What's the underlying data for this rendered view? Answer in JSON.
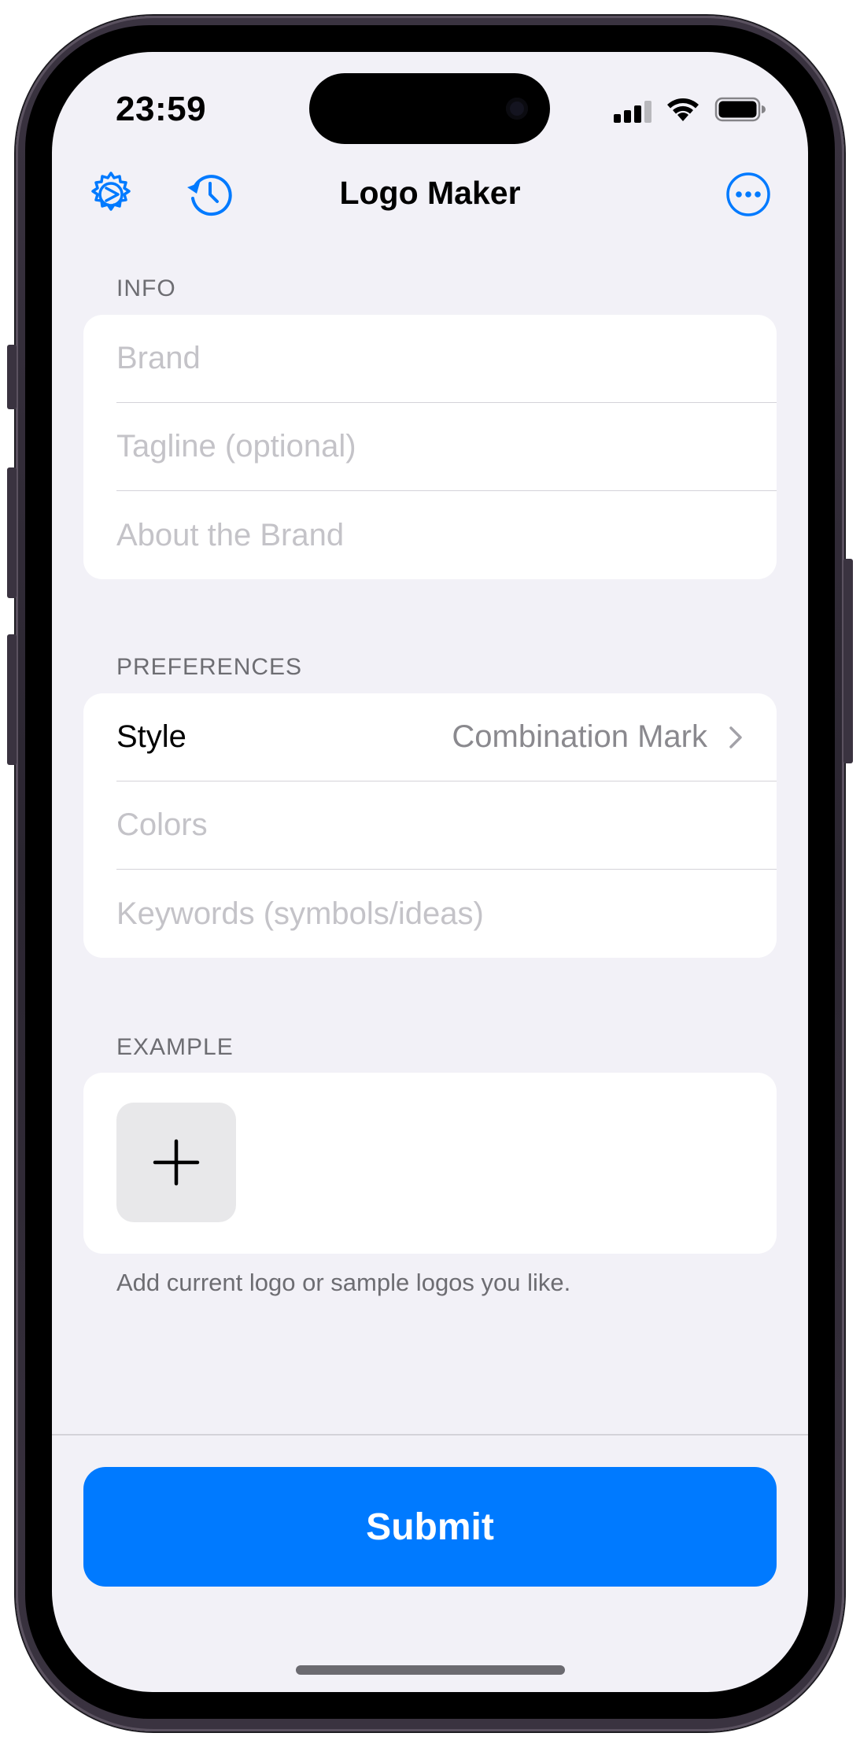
{
  "status_bar": {
    "time": "23:59"
  },
  "nav": {
    "title": "Logo Maker",
    "icons": [
      "gear-play-icon",
      "clock-history-icon",
      "ellipsis-circle-icon"
    ]
  },
  "info_section": {
    "header": "INFO",
    "fields": [
      {
        "placeholder": "Brand",
        "value": ""
      },
      {
        "placeholder": "Tagline (optional)",
        "value": ""
      },
      {
        "placeholder": "About the Brand",
        "value": ""
      }
    ]
  },
  "preferences_section": {
    "header": "PREFERENCES",
    "style": {
      "label": "Style",
      "value": "Combination Mark"
    },
    "fields": [
      {
        "placeholder": "Colors",
        "value": ""
      },
      {
        "placeholder": "Keywords (symbols/ideas)",
        "value": ""
      }
    ]
  },
  "example_section": {
    "header": "EXAMPLE",
    "footer": "Add current logo or sample logos you like."
  },
  "submit": {
    "label": "Submit"
  },
  "colors": {
    "accent": "#007aff",
    "background": "#f2f1f7",
    "card": "#ffffff",
    "placeholder": "#c4c3c8",
    "secondary_text": "#6d6d72"
  }
}
